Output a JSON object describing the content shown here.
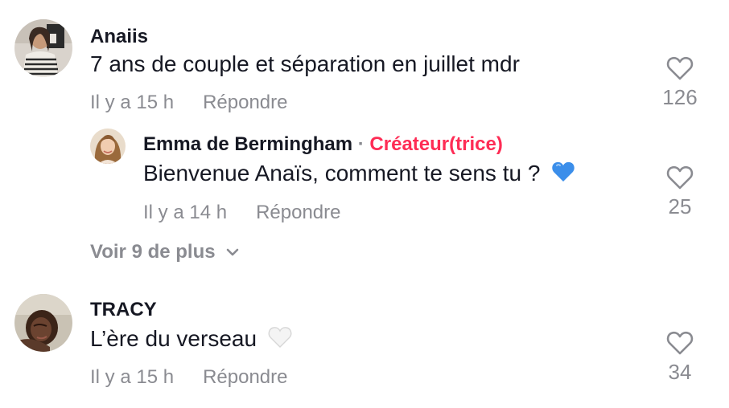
{
  "comments": [
    {
      "username": "Anaiis",
      "text": "7 ans de couple et séparation en juillet mdr",
      "time": "Il y a 15 h",
      "reply_label": "Répondre",
      "like_count": "126",
      "replies": [
        {
          "username": "Emma de Bermingham",
          "creator_separator": "·",
          "creator_label": "Créateur(trice)",
          "text": "Bienvenue Anaïs, comment te sens tu ?",
          "emoji": "blue-heart",
          "time": "Il y a 14 h",
          "reply_label": "Répondre",
          "like_count": "25"
        }
      ],
      "view_more_label": "Voir 9 de plus"
    },
    {
      "username": "TRACY",
      "text": "L’ère du verseau",
      "emoji": "white-heart",
      "time": "Il y a 15 h",
      "reply_label": "Répondre",
      "like_count": "34"
    }
  ],
  "colors": {
    "text": "#161823",
    "muted": "#8a8b91",
    "creator": "#fe2c55",
    "blue_heart": "#3b8eea"
  },
  "icons": {
    "like": "heart-outline-icon",
    "expand": "chevron-down-icon"
  }
}
